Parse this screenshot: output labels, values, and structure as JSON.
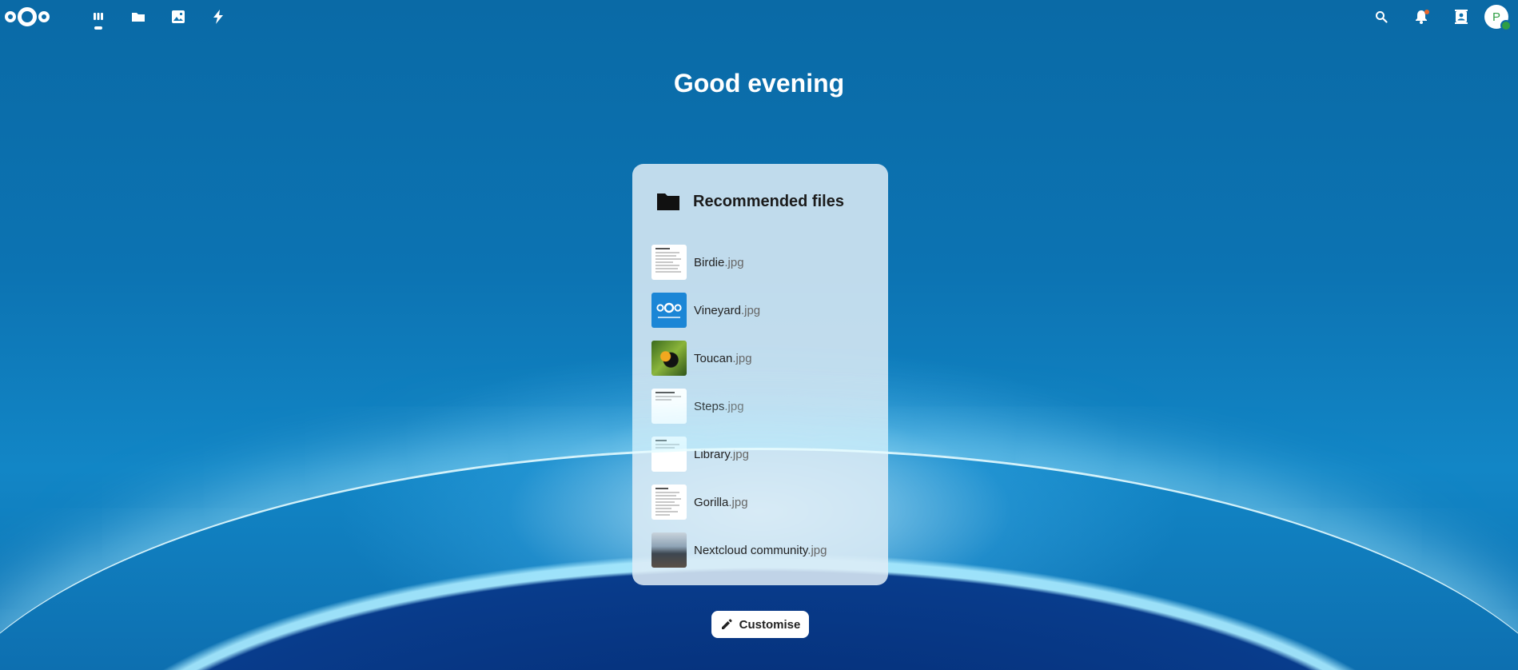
{
  "header": {
    "logo_icon": "nextcloud-logo",
    "nav": [
      {
        "name": "dashboard",
        "icon": "dashboard-icon",
        "active": true
      },
      {
        "name": "files",
        "icon": "folder-icon",
        "active": false
      },
      {
        "name": "photos",
        "icon": "image-icon",
        "active": false
      },
      {
        "name": "activity",
        "icon": "lightning-icon",
        "active": false
      }
    ],
    "right": [
      {
        "name": "search",
        "icon": "search-icon"
      },
      {
        "name": "notifications",
        "icon": "bell-icon"
      },
      {
        "name": "contacts",
        "icon": "contacts-icon"
      }
    ],
    "avatar_initial": "P",
    "status_color": "#2f9e44",
    "notification_dot_color": "#e9662c"
  },
  "greeting": "Good evening",
  "widget": {
    "title": "Recommended files",
    "icon": "folder-icon",
    "files": [
      {
        "base": "Birdie",
        "ext": ".jpg",
        "thumb": "document"
      },
      {
        "base": "Vineyard",
        "ext": ".jpg",
        "thumb": "nextcloud-blue"
      },
      {
        "base": "Toucan",
        "ext": ".jpg",
        "thumb": "photo-toucan"
      },
      {
        "base": "Steps",
        "ext": ".jpg",
        "thumb": "document"
      },
      {
        "base": "Library",
        "ext": ".jpg",
        "thumb": "document"
      },
      {
        "base": "Gorilla",
        "ext": ".jpg",
        "thumb": "document"
      },
      {
        "base": "Nextcloud community",
        "ext": ".jpg",
        "thumb": "photo-community"
      }
    ]
  },
  "customise_button": {
    "label": "Customise",
    "icon": "pencil-icon"
  }
}
